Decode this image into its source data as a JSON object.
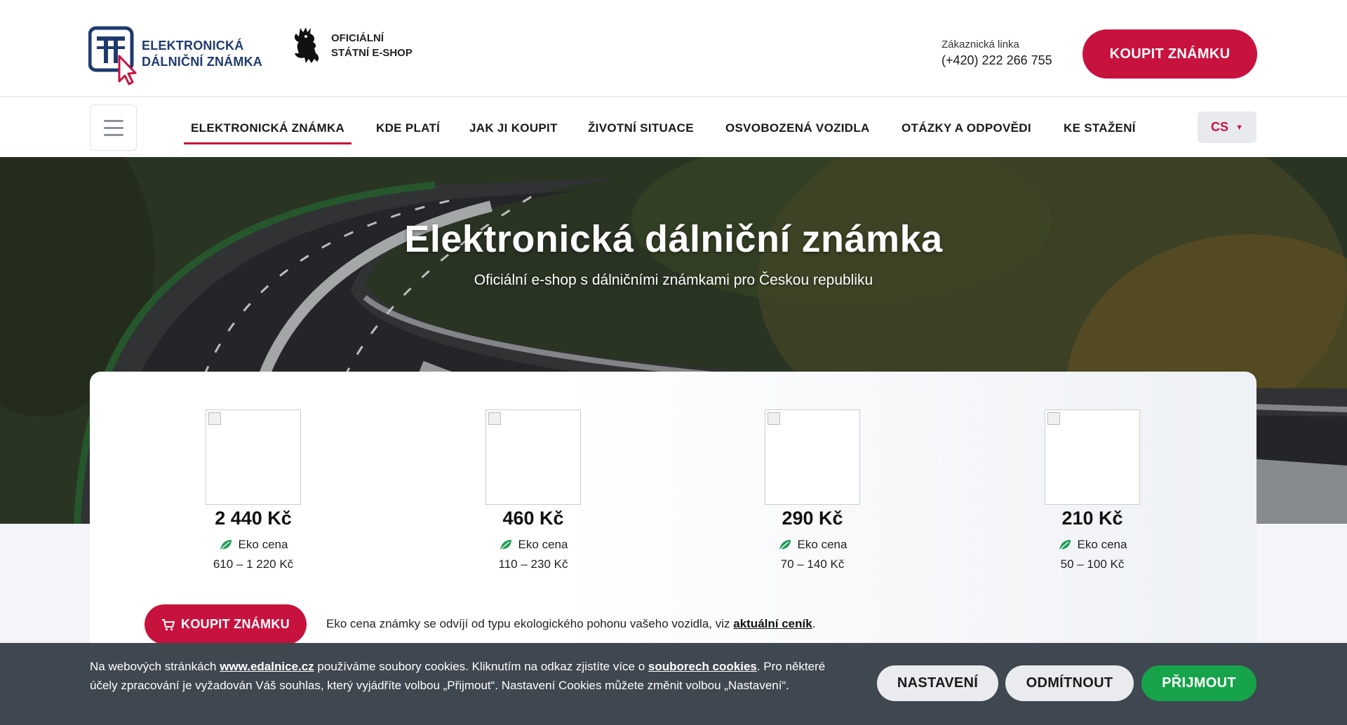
{
  "header": {
    "logo_line1": "ELEKTRONICKÁ",
    "logo_line2": "DÁLNIČNÍ ZNÁMKA",
    "state_line1": "OFICIÁLNÍ",
    "state_line2": "STÁTNÍ E-SHOP",
    "hotline_label": "Zákaznická linka",
    "hotline_number": "(+420) 222 266 755",
    "buy_button": "KOUPIT ZNÁMKU"
  },
  "nav": {
    "items": [
      {
        "label": "ELEKTRONICKÁ ZNÁMKA",
        "active": true
      },
      {
        "label": "KDE PLATÍ"
      },
      {
        "label": "JAK JI KOUPIT"
      },
      {
        "label": "ŽIVOTNÍ SITUACE"
      },
      {
        "label": "OSVOBOZENÁ VOZIDLA"
      },
      {
        "label": "OTÁZKY A ODPOVĚDI"
      },
      {
        "label": "KE STAŽENÍ"
      }
    ],
    "language": "CS"
  },
  "hero": {
    "title": "Elektronická dálniční známka",
    "subtitle": "Oficiální e-shop s dálničními známkami pro Českou republiku"
  },
  "prices": [
    {
      "price": "2 440 Kč",
      "eko_label": "Eko cena",
      "eko_range": "610 – 1 220 Kč"
    },
    {
      "price": "460 Kč",
      "eko_label": "Eko cena",
      "eko_range": "110 – 230 Kč"
    },
    {
      "price": "290 Kč",
      "eko_label": "Eko cena",
      "eko_range": "70 – 140 Kč"
    },
    {
      "price": "210 Kč",
      "eko_label": "Eko cena",
      "eko_range": "50 – 100 Kč"
    }
  ],
  "card": {
    "buy_button": "KOUPIT ZNÁMKU",
    "note_before": "Eko cena známky se odvíjí od typu ekologického pohonu vašeho vozidla, viz ",
    "note_link": "aktuální ceník",
    "note_after": "."
  },
  "cookie": {
    "text1": "Na webových stránkách ",
    "link1": "www.edalnice.cz",
    "text2": " používáme soubory cookies. Kliknutím na odkaz zjistíte více o ",
    "link2": "souborech cookies",
    "text3": ". Pro některé účely zpracování je vyžadován Váš souhlas, který vyjádříte volbou „Přijmout“. Nastavení Cookies můžete změnit volbou „Nastavení“.",
    "btn_settings": "NASTAVENÍ",
    "btn_reject": "ODMÍTNOUT",
    "btn_accept": "PŘIJMOUT"
  },
  "colors": {
    "brand_red": "#c8123e",
    "brand_blue": "#1f3b6e",
    "accept_green": "#16a34a",
    "cookie_bg": "#3f4751"
  },
  "icons": [
    "motorway-logo-icon",
    "cursor-arrow-icon",
    "czech-lion-icon",
    "hamburger-icon",
    "chevron-down-icon",
    "leaf-icon",
    "cart-icon"
  ]
}
